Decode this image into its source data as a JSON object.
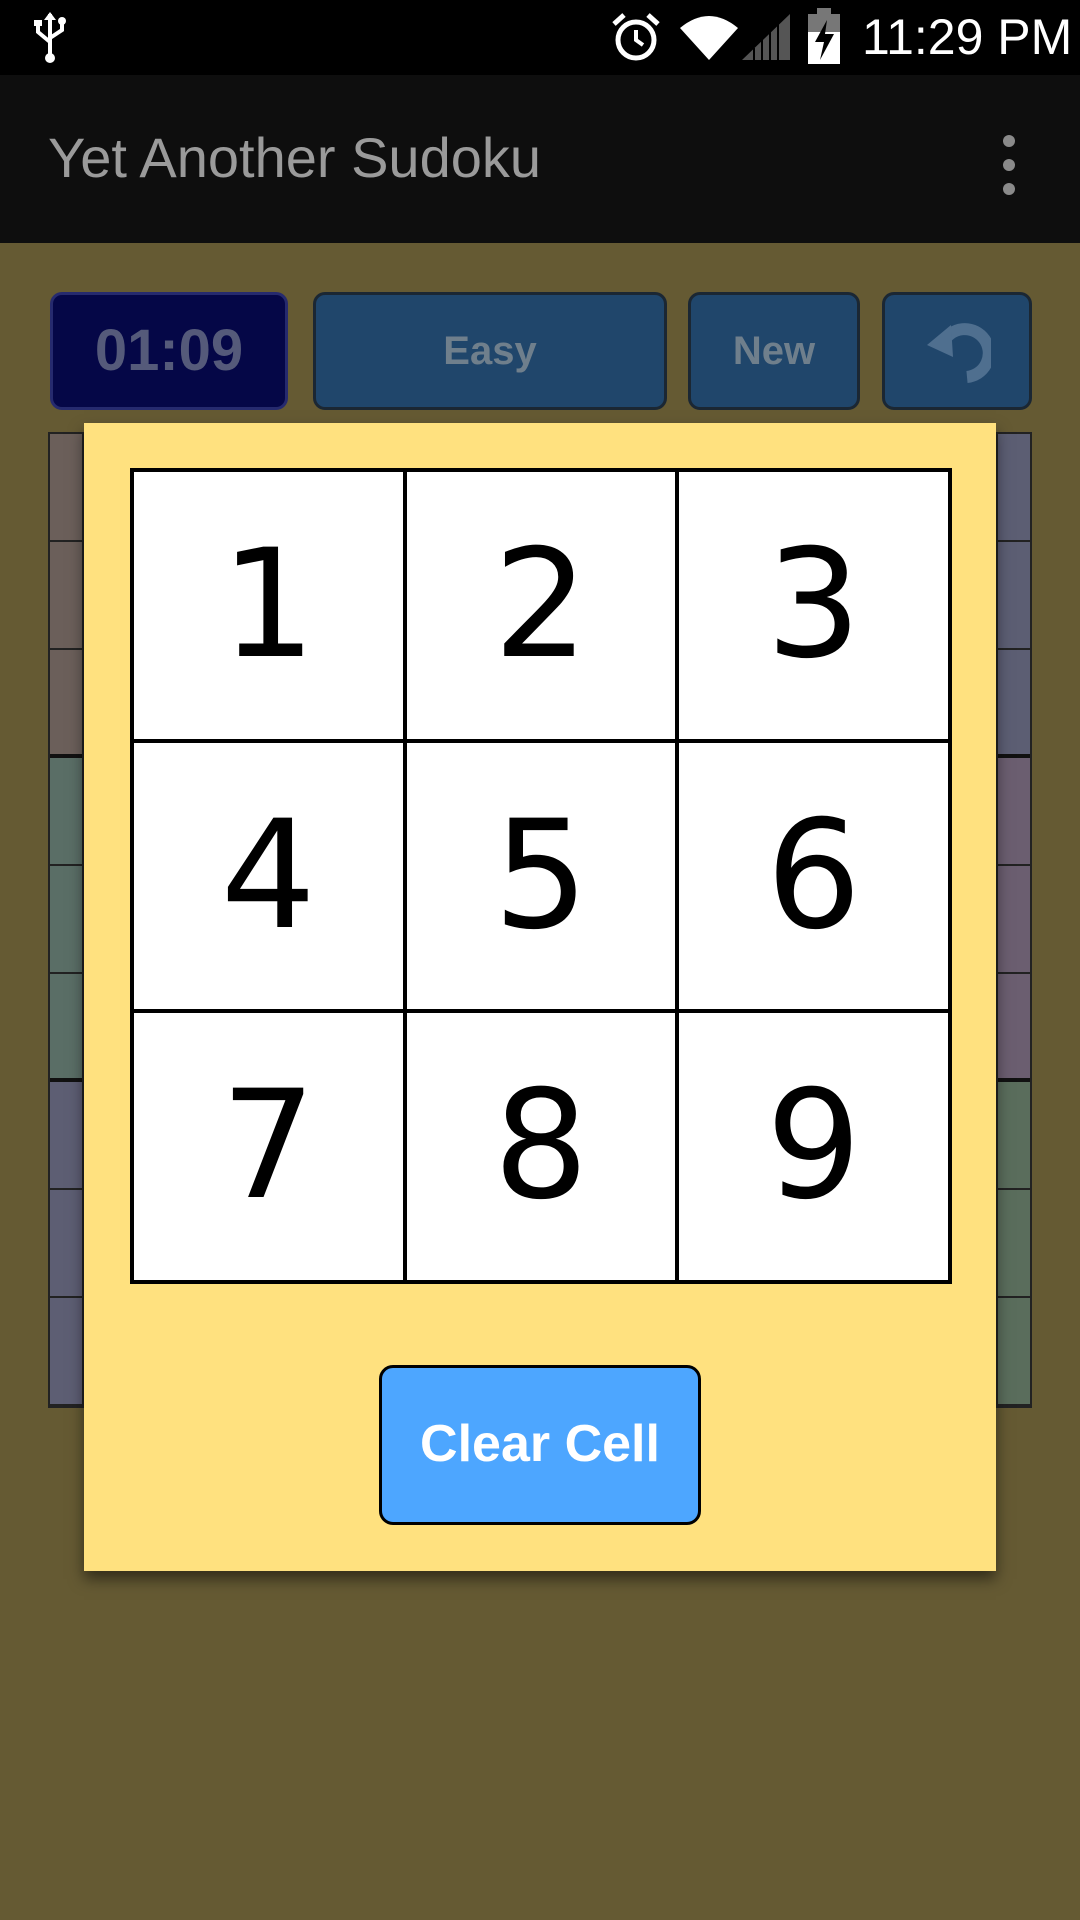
{
  "status_bar": {
    "time": "11:29 PM",
    "icons": [
      "usb-icon",
      "alarm-icon",
      "wifi-icon",
      "signal-icon",
      "battery-charging-icon"
    ]
  },
  "app_bar": {
    "title": "Yet Another Sudoku",
    "menu_icon": "overflow-menu-icon"
  },
  "controls": {
    "timer": "01:09",
    "difficulty": "Easy",
    "new_label": "New",
    "undo_icon": "undo-icon"
  },
  "board": {
    "left_strip_colors": [
      "#6b5f5a",
      "#6b5f5a",
      "#6b5f5a",
      "#5a6e66",
      "#5a6e66",
      "#5a6e66",
      "#5d5e73",
      "#5d5e73",
      "#5d5e73"
    ],
    "right_strip_colors": [
      "#5c5e73",
      "#5c5e73",
      "#5c5e73",
      "#6b5e70",
      "#6b5e70",
      "#6b5e70",
      "#5a6d5c",
      "#5a6d5c",
      "#5a6d5c"
    ]
  },
  "number_picker": {
    "keys": [
      "1",
      "2",
      "3",
      "4",
      "5",
      "6",
      "7",
      "8",
      "9"
    ],
    "clear_label": "Clear Cell"
  },
  "colors": {
    "background": "#655a33",
    "dialog": "#ffe17f",
    "clear_button": "#4da6ff",
    "control_button": "#20466b",
    "timer": "#050747"
  }
}
